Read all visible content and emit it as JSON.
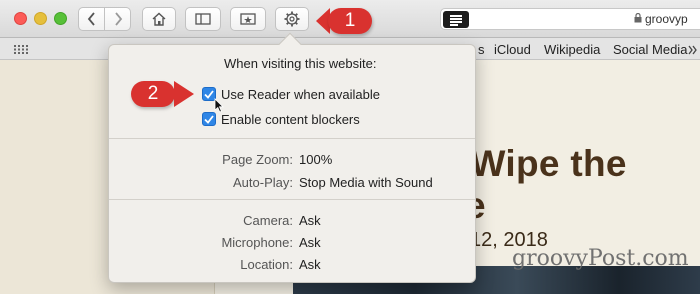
{
  "toolbar": {
    "url": "groovyp",
    "colors": {
      "close": "#fc5b57",
      "minimize": "#e5bf3c",
      "zoom": "#57c038"
    },
    "buttons": [
      "back-icon",
      "forward-icon",
      "home-icon",
      "sidebar-icon",
      "topsites-icon",
      "gear-icon"
    ]
  },
  "favorites": [
    "s",
    "iCloud",
    "Wikipedia",
    "Social Media"
  ],
  "article": {
    "title_line1": "urely Wipe the",
    "title_line2": "e",
    "date": "12, 2018",
    "watermark": "groovyPost.com"
  },
  "popover": {
    "heading": "When visiting this website:",
    "use_reader": {
      "label": "Use Reader when available",
      "checked": true
    },
    "content_blockers": {
      "label": "Enable content blockers",
      "checked": true
    },
    "page_zoom": {
      "label": "Page Zoom:",
      "value": "100%"
    },
    "auto_play": {
      "label": "Auto-Play:",
      "value": "Stop Media with Sound"
    },
    "camera": {
      "label": "Camera:",
      "value": "Ask"
    },
    "microphone": {
      "label": "Microphone:",
      "value": "Ask"
    },
    "location": {
      "label": "Location:",
      "value": "Ask"
    }
  },
  "callouts": {
    "one": "1",
    "two": "2",
    "color": "#d9322f"
  }
}
